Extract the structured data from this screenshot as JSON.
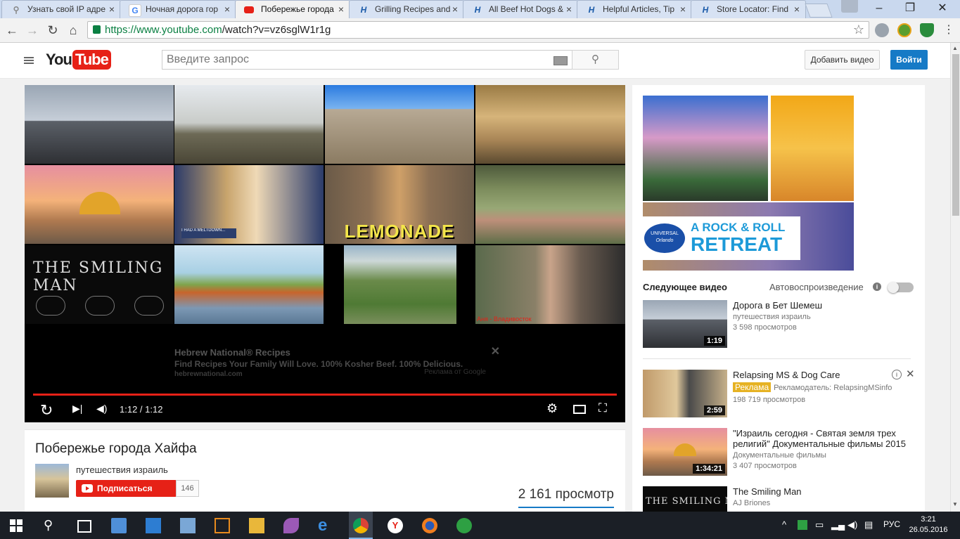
{
  "browser": {
    "tabs": [
      {
        "title": "Узнать свой IP адре",
        "icon": "search-icon"
      },
      {
        "title": "Ночная дорога гор",
        "icon": "google-icon"
      },
      {
        "title": "Побережье города",
        "icon": "youtube-icon",
        "active": true
      },
      {
        "title": "Grilling Recipes and",
        "icon": "hebrew-national-icon"
      },
      {
        "title": "All Beef Hot Dogs &",
        "icon": "hebrew-national-icon"
      },
      {
        "title": "Helpful Articles, Tip",
        "icon": "hebrew-national-icon"
      },
      {
        "title": "Store Locator: Find",
        "icon": "hebrew-national-icon"
      }
    ],
    "url_host": "https://www.youtube.com",
    "url_path": "/watch?v=vz6sglW1r1g"
  },
  "youtube": {
    "logo_you": "You",
    "logo_tube": "Tube",
    "search_placeholder": "Введите запрос",
    "upload_label": "Добавить видео",
    "signin_label": "Войти"
  },
  "player": {
    "thumb_texts": {
      "lemonade": "LEMONADE",
      "smiling_man": "THE SMILING MAN",
      "anya": "Аня - Владивосток",
      "thumb_caption": "I HAD A MELTDOWN..."
    },
    "ad": {
      "title": "Hebrew National® Recipes",
      "description": "Find Recipes Your Family Will Love. 100% Kosher Beef. 100% Delicious.",
      "url": "hebrewnational.com",
      "by": "Реклама от Google",
      "close": "✕"
    },
    "time": "1:12 / 1:12",
    "progress": 1.0
  },
  "video": {
    "title": "Побережье города Хайфа",
    "channel": "путешествия израиль",
    "subscribe_label": "Подписаться",
    "subscriber_count": "146",
    "views": "2 161 просмотр"
  },
  "sidebar": {
    "ad_banner": {
      "line1": "A ROCK & ROLL",
      "line2": "RETREAT",
      "badge1": "UNIVERSAL",
      "badge2": "Orlando"
    },
    "up_next_label": "Следующее видео",
    "autoplay_label": "Автовоспроизведение",
    "autoplay_on": false,
    "videos": [
      {
        "title": "Дорога в Бет Шемеш",
        "channel": "путешествия израиль",
        "views": "3 598 просмотров",
        "duration": "1:19"
      },
      {
        "title": "Relapsing MS & Dog Care",
        "ad_badge": "Реклама",
        "channel": "Рекламодатель: RelapsingMSinfo",
        "views": "198 719 просмотров",
        "duration": "2:59"
      },
      {
        "title": "\"Израиль сегодня - Святая земля трех религий\" Документальные фильмы 2015",
        "channel": "Документальные фильмы",
        "views": "3 407 просмотров",
        "duration": "1:34:21"
      },
      {
        "title": "The Smiling Man",
        "channel": "AJ Briones",
        "thumb_text": "THE SMILING MAN"
      }
    ]
  },
  "taskbar": {
    "lang": "РУС",
    "time": "3:21",
    "date": "26.05.2016"
  }
}
